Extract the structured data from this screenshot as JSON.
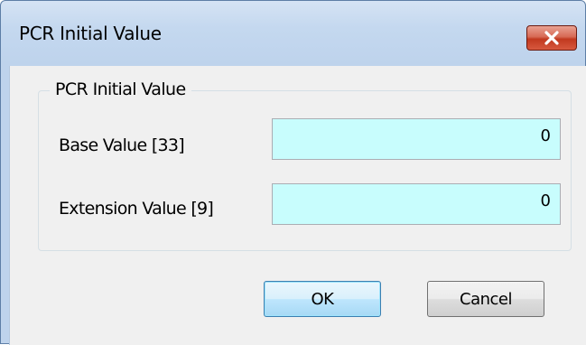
{
  "window": {
    "title": "PCR Initial Value",
    "close_icon": "close-icon"
  },
  "group": {
    "legend": "PCR Initial Value"
  },
  "fields": {
    "base": {
      "label": "Base Value [33]",
      "value": "0"
    },
    "extension": {
      "label": "Extension Value [9]",
      "value": "0"
    }
  },
  "buttons": {
    "ok": "OK",
    "cancel": "Cancel"
  },
  "colors": {
    "input_background": "#c8fdfd",
    "close_button": "#c7452c",
    "title_bar": "#c4d8ef"
  }
}
